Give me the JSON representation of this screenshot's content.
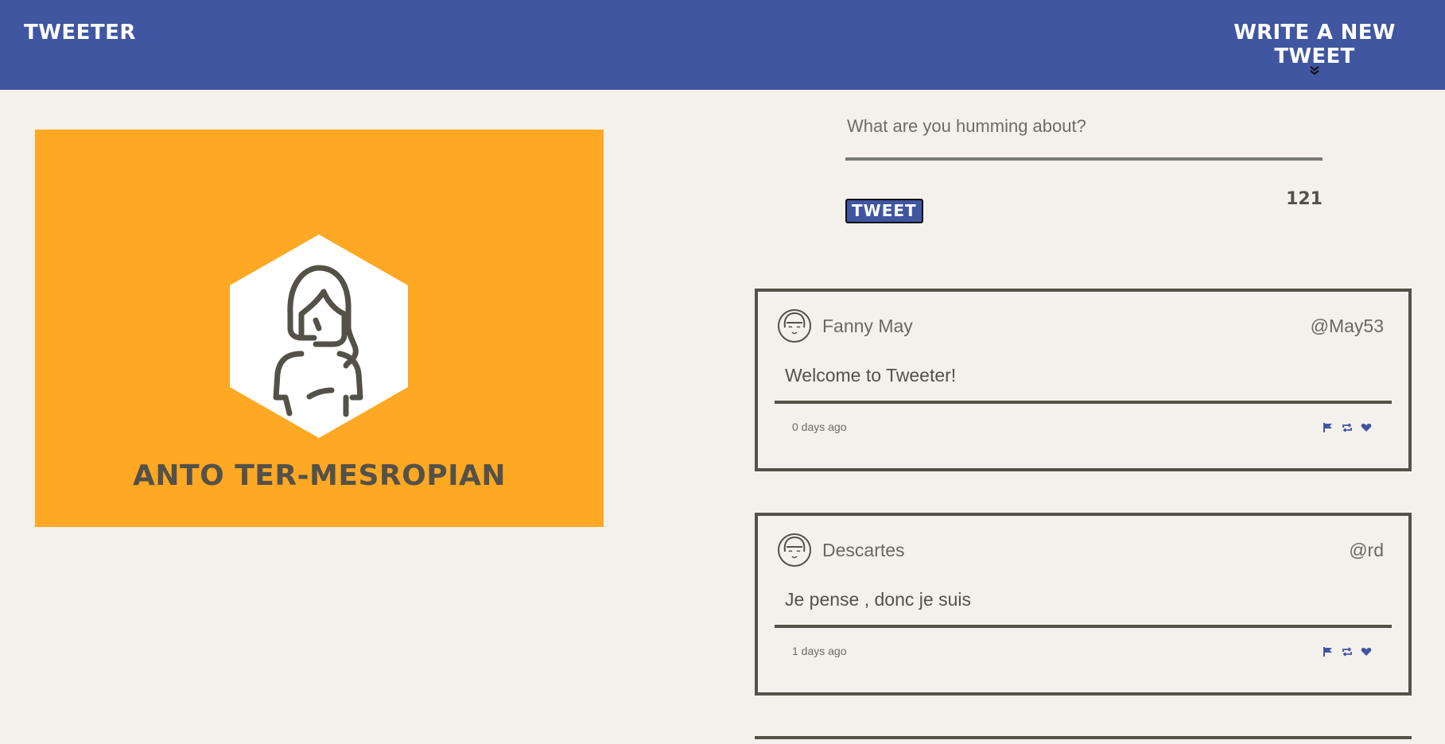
{
  "nav": {
    "brand": "TWEETER",
    "compose_label": "WRITE A NEW TWEET",
    "compose_icon": "double-chevron-down-icon"
  },
  "profile": {
    "name": "ANTO TER-MESROPIAN",
    "avatar_icon": "woman-avatar-icon"
  },
  "composer": {
    "placeholder": "What are you humming about?",
    "value": "",
    "button_label": "TWEET",
    "char_count": "121"
  },
  "tweets": [
    {
      "name": "Fanny May",
      "handle": "@May53",
      "content": "Welcome to Tweeter!",
      "time": "0 days ago"
    },
    {
      "name": "Descartes",
      "handle": "@rd",
      "content": "Je pense , donc je suis",
      "time": "1 days ago"
    }
  ],
  "colors": {
    "nav_bg": "#4056a1",
    "page_bg": "#f4f1ec",
    "profile_bg": "#ffa823",
    "text_dark": "#545149",
    "icon_blue": "#4056a1"
  }
}
